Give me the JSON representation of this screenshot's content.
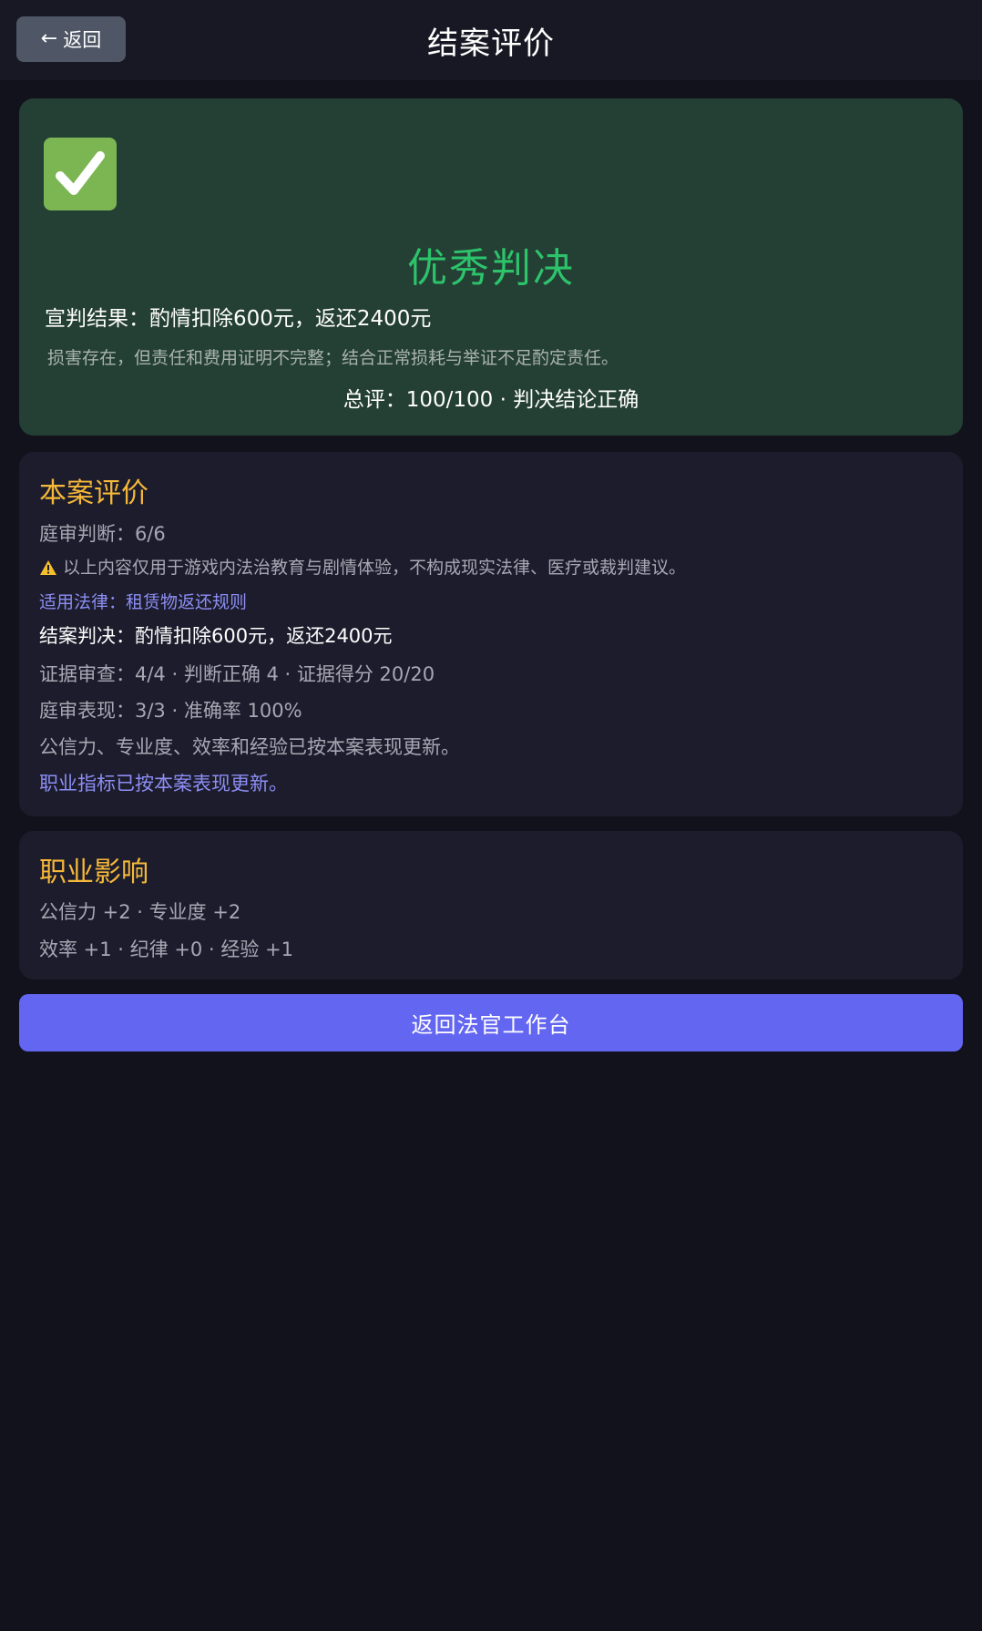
{
  "header": {
    "back_label": "返回",
    "title": "结案评价"
  },
  "verdict": {
    "icon": "check-icon",
    "title": "优秀判决",
    "announcement": "宣判结果：酌情扣除600元，返还2400元",
    "reason": "损害存在，但责任和费用证明不完整；结合正常损耗与举证不足酌定责任。",
    "score": "总评：100/100 · 判决结论正确"
  },
  "evaluation": {
    "title": "本案评价",
    "trial_judgement": "庭审判断：6/6",
    "disclaimer": "以上内容仅用于游戏内法治教育与剧情体验，不构成现实法律、医疗或裁判建议。",
    "law": "适用法律：租赁物返还规则",
    "final_ruling": "结案判决：酌情扣除600元，返还2400元",
    "evidence_review": "证据审查：4/4 · 判断正确 4 · 证据得分 20/20",
    "trial_performance": "庭审表现：3/3 · 准确率 100%",
    "stats_updated": "公信力、专业度、效率和经验已按本案表现更新。",
    "metrics_updated": "职业指标已按本案表现更新。"
  },
  "career": {
    "title": "职业影响",
    "line1": "公信力 +2 · 专业度 +2",
    "line2": "效率 +1 · 纪律 +0 · 经验 +1"
  },
  "actions": {
    "return_label": "返回法官工作台"
  },
  "colors": {
    "accent": "#6366f1",
    "success": "#2cc36b",
    "section_title": "#f5b839",
    "link": "#8d8ef5"
  }
}
